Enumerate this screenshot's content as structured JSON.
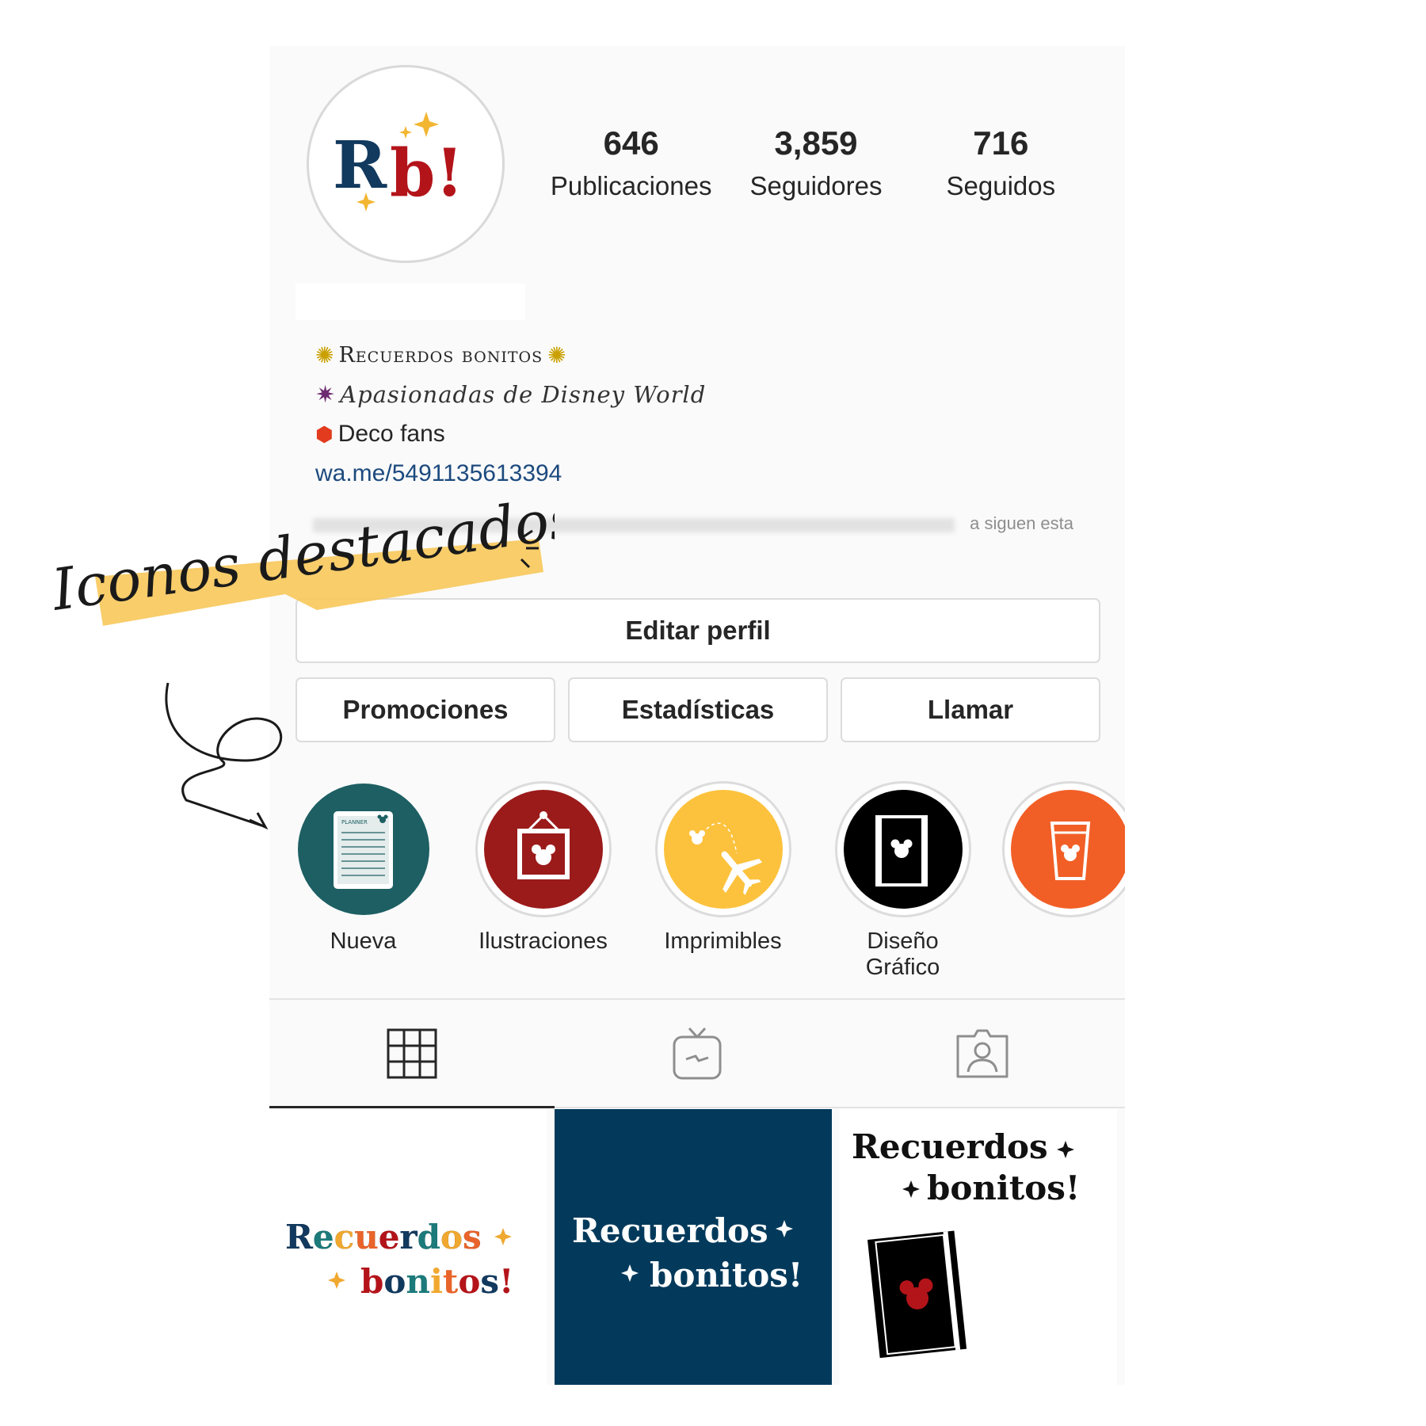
{
  "profile": {
    "avatar_text": "Rb!",
    "stats": [
      {
        "value": "646",
        "label": "Publicaciones"
      },
      {
        "value": "3,859",
        "label": "Seguidores"
      },
      {
        "value": "716",
        "label": "Seguidos"
      }
    ],
    "bio": {
      "line1": "Recuerdos bonitos",
      "line2": "Apasionadas de Disney World",
      "line3": "Deco fans",
      "link": "wa.me/5491135613394"
    },
    "followers_note": "a siguen esta"
  },
  "buttons": {
    "edit": "Editar perfil",
    "promotions": "Promociones",
    "stats": "Estadísticas",
    "call": "Llamar"
  },
  "highlights": [
    {
      "label": "Nueva",
      "color": "#1d5f63",
      "icon": "planner-icon",
      "icon_text": "PLANNER"
    },
    {
      "label": "Ilustraciones",
      "color": "#9b1b1b",
      "icon": "frame-icon"
    },
    {
      "label": "Imprimibles",
      "color": "#fcc23d",
      "icon": "airplane-icon"
    },
    {
      "label": "Diseño Gráfico",
      "color": "#000000",
      "icon": "notebook-icon"
    },
    {
      "label": "",
      "color": "#f15f26",
      "icon": "cup-icon"
    }
  ],
  "tabs": [
    {
      "name": "grid-icon",
      "active": true
    },
    {
      "name": "igtv-icon",
      "active": false
    },
    {
      "name": "tagged-icon",
      "active": false
    }
  ],
  "posts": [
    {
      "line1": "Recuerdos",
      "line2": "bonitos!",
      "bg": "#ffffff"
    },
    {
      "line1": "Recuerdos",
      "line2": "bonitos!",
      "bg": "#033a5b"
    },
    {
      "line1": "Recuerdos",
      "line2": "bonitos!",
      "bg": "#ffffff"
    }
  ],
  "annotation": {
    "text": "Iconos destacados",
    "highlight_color": "#f7c85a"
  }
}
